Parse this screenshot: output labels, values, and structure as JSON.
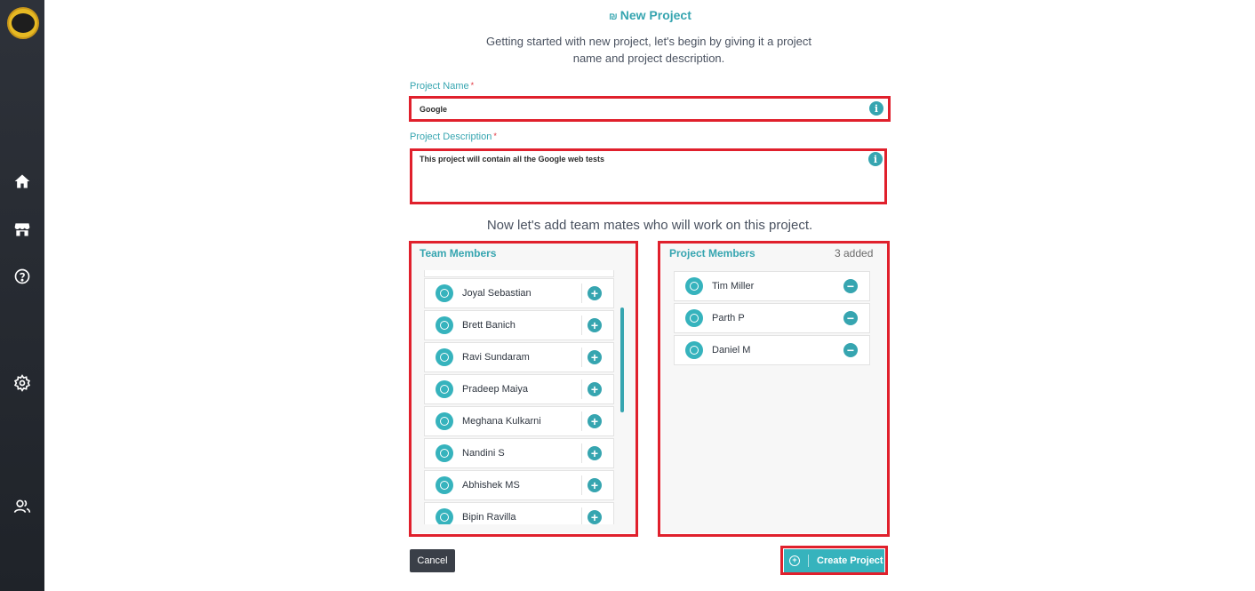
{
  "page": {
    "title": "New Project",
    "title_glyph": "₪",
    "subtitle": "Getting started with new project, let's begin by giving it a project name and project description."
  },
  "form": {
    "name_label": "Project Name",
    "name_value": "Google",
    "description_label": "Project Description",
    "description_value": "This project will contain all the Google web tests",
    "required_mark": "*"
  },
  "team_section": {
    "heading": "Now let's add team mates who will work on this project.",
    "team_title": "Team Members",
    "team_members": [
      "Joyal Sebastian",
      "Brett Banich",
      "Ravi Sundaram",
      "Pradeep Maiya",
      "Meghana Kulkarni",
      "Nandini S",
      "Abhishek MS",
      "Bipin Ravilla"
    ],
    "project_title": "Project Members",
    "project_count": "3 added",
    "project_members": [
      "Tim Miller",
      "Parth P",
      "Daniel M"
    ]
  },
  "actions": {
    "cancel_label": "Cancel",
    "create_label": "Create Project"
  },
  "sidebar": {
    "icons": [
      "logo",
      "home-icon",
      "store-icon",
      "help-icon",
      "settings-icon",
      "users-icon"
    ]
  },
  "colors": {
    "accent": "#36a5b0",
    "highlight": "#e0202c",
    "sidebar": "#2a2e35"
  }
}
